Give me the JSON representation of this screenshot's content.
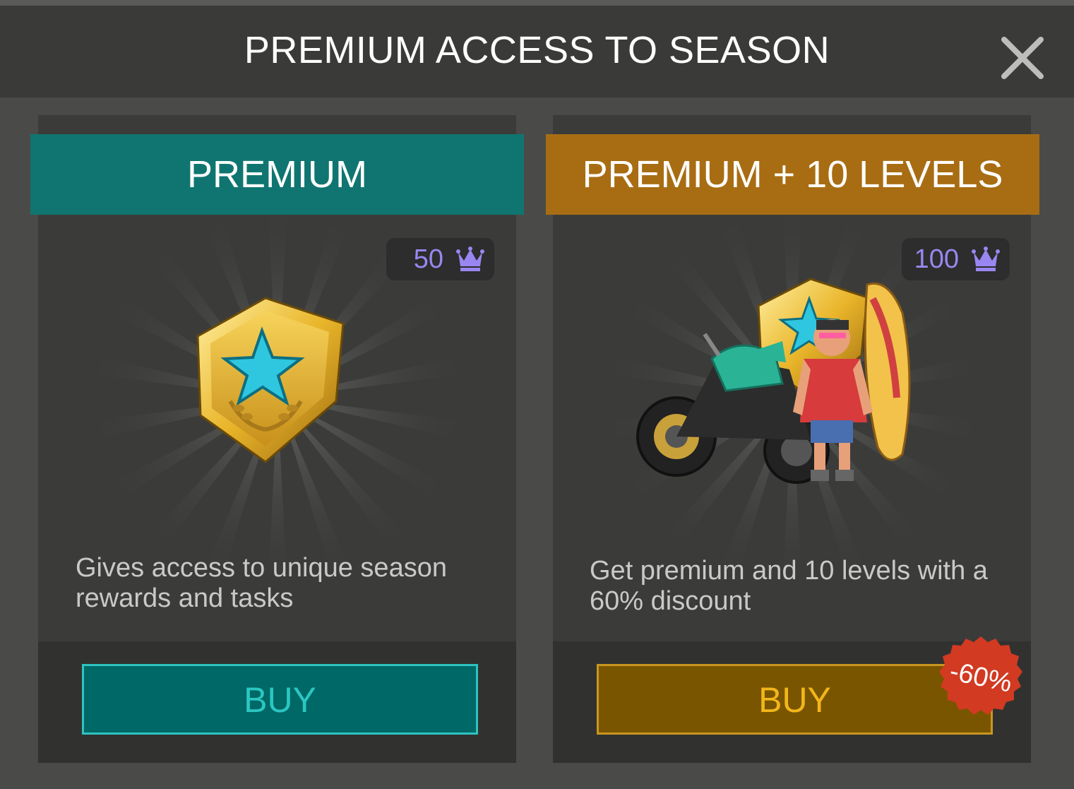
{
  "header": {
    "title": "PREMIUM ACCESS TO SEASON"
  },
  "cards": [
    {
      "banner": "PREMIUM",
      "price": "50",
      "price_icon": "crown-icon",
      "description": "Gives access to unique season rewards and tasks",
      "buy_label": "BUY",
      "accent": "#107570"
    },
    {
      "banner": "PREMIUM + 10 LEVELS",
      "price": "100",
      "price_icon": "crown-icon",
      "description": "Get premium and 10 levels with a 60% discount",
      "buy_label": "BUY",
      "discount_badge": "-60%",
      "accent": "#a86d12"
    }
  ],
  "colors": {
    "background": "#4a4b49",
    "header": "#3a3b39",
    "price_text": "#9a86f0",
    "badge": "#d23a22"
  }
}
